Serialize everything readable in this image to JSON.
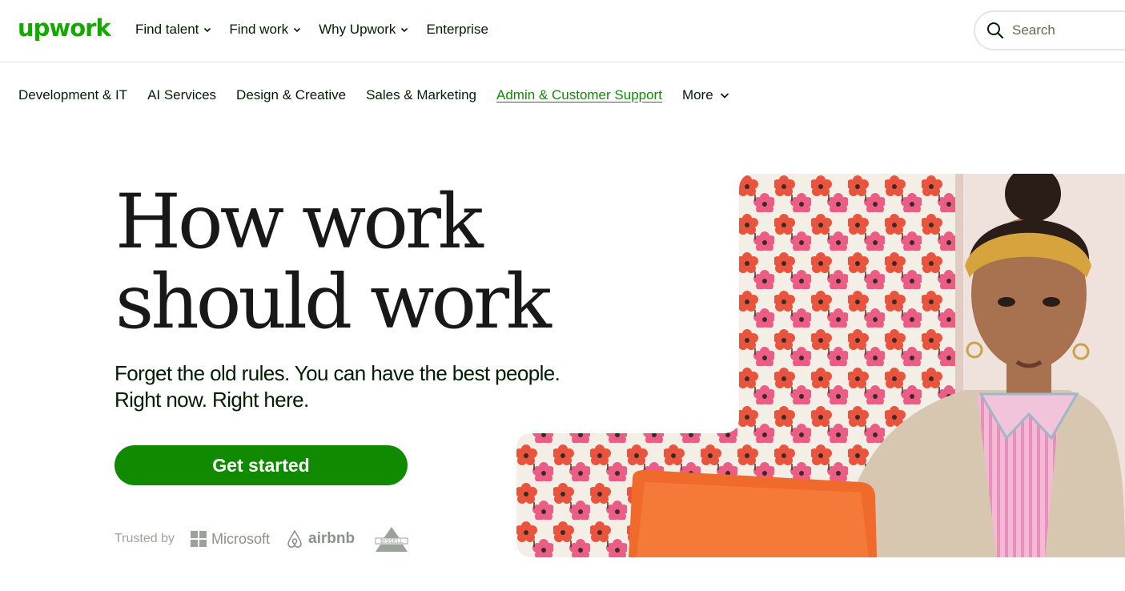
{
  "header": {
    "logo": "upwork",
    "nav": [
      {
        "label": "Find talent",
        "has_dropdown": true
      },
      {
        "label": "Find work",
        "has_dropdown": true
      },
      {
        "label": "Why Upwork",
        "has_dropdown": true
      },
      {
        "label": "Enterprise",
        "has_dropdown": false
      }
    ],
    "search": {
      "placeholder": "Search",
      "icon": "search-icon"
    }
  },
  "categories": {
    "items": [
      {
        "label": "Development & IT",
        "active": false
      },
      {
        "label": "AI Services",
        "active": false
      },
      {
        "label": "Design & Creative",
        "active": false
      },
      {
        "label": "Sales & Marketing",
        "active": false
      },
      {
        "label": "Admin & Customer Support",
        "active": true
      }
    ],
    "more_label": "More"
  },
  "hero": {
    "headline_line1": "How work",
    "headline_line2": "should work",
    "subhead_line1": "Forget the old rules. You can have the best people.",
    "subhead_line2": "Right now. Right here.",
    "cta_label": "Get started",
    "trusted_label": "Trusted by",
    "trusted_brands": [
      "Microsoft",
      "airbnb",
      "BISSELL"
    ]
  },
  "colors": {
    "brand_green": "#14a800",
    "cta_green": "#108a00",
    "text": "#001e00"
  }
}
